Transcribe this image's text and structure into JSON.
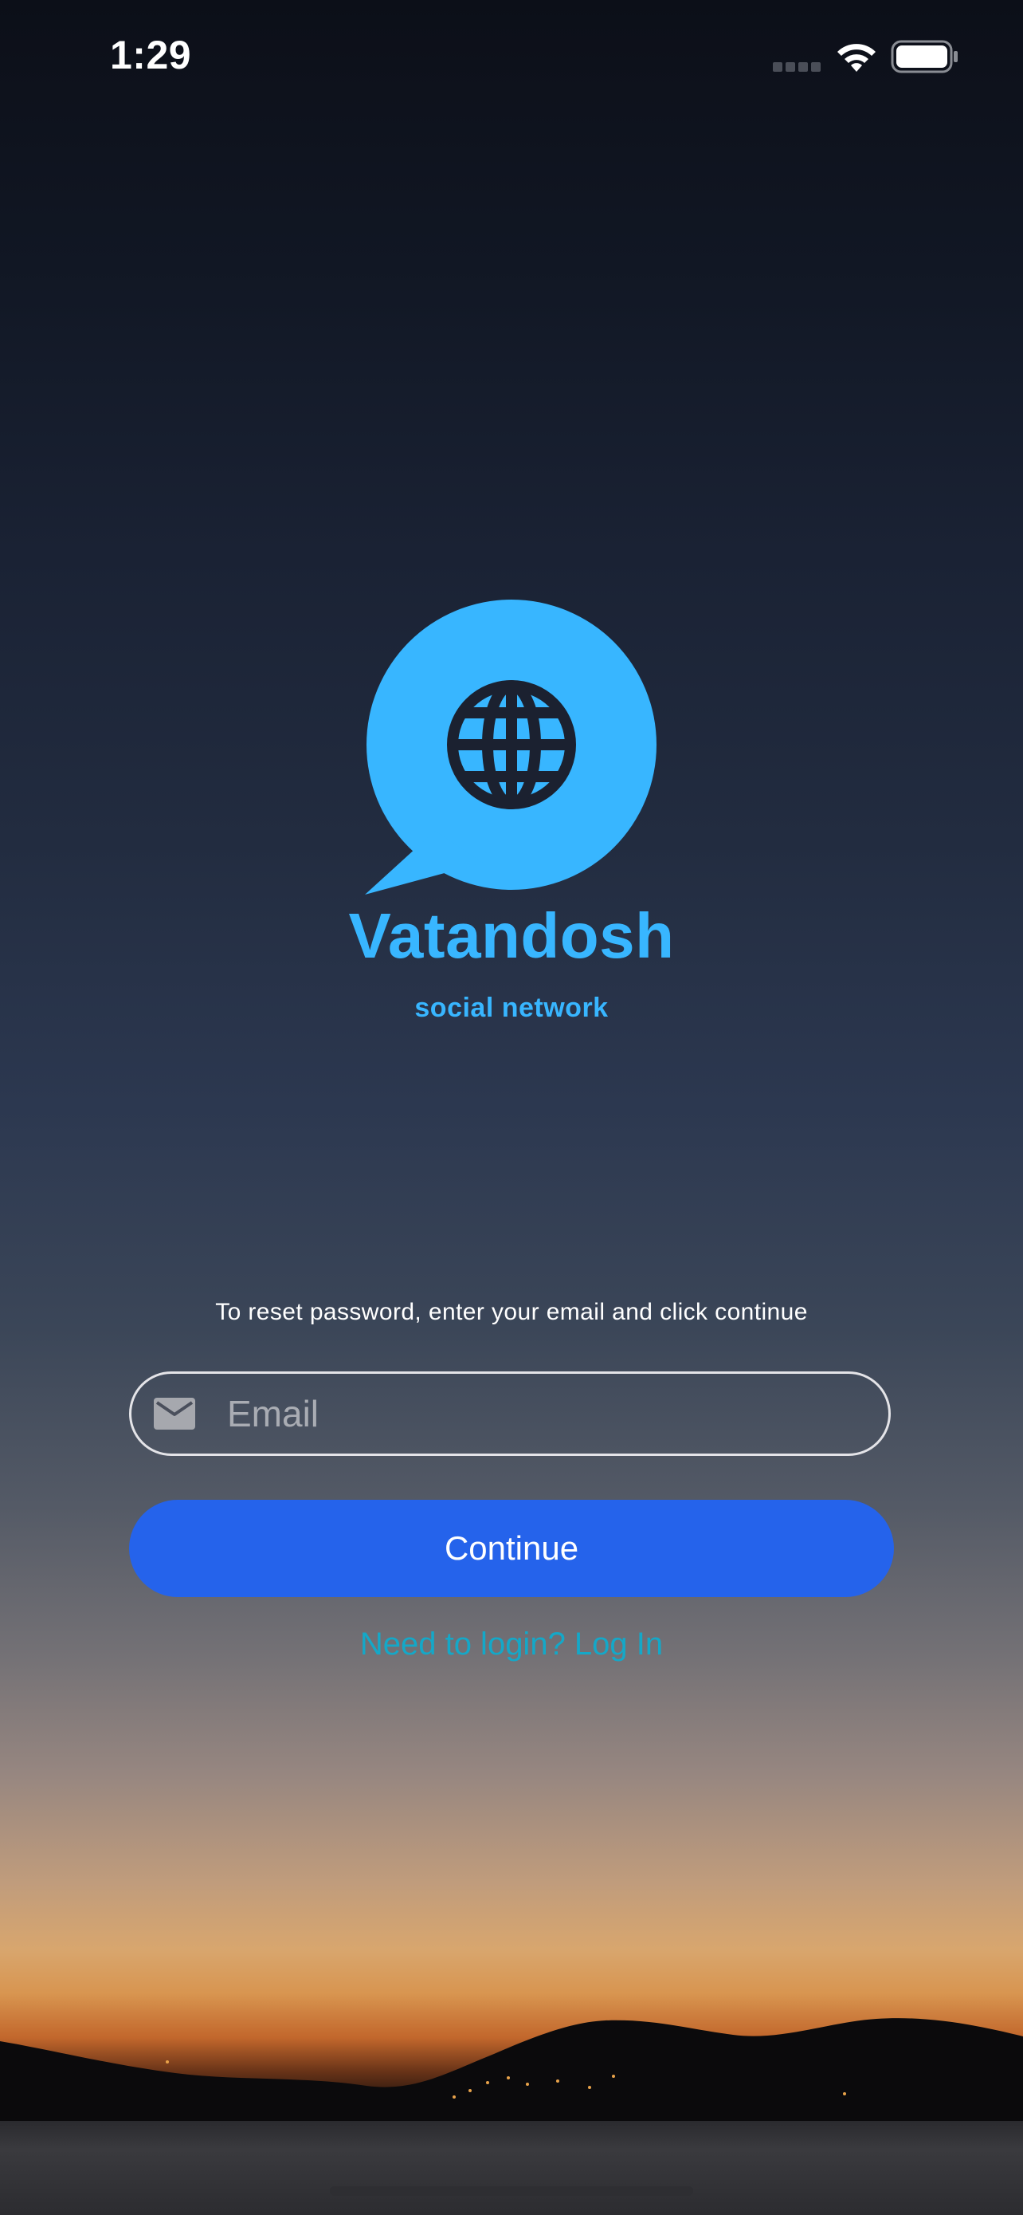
{
  "status_bar": {
    "time": "1:29",
    "icons": [
      "cellular-signal-icon",
      "wifi-icon",
      "battery-icon"
    ]
  },
  "brand": {
    "logo_icon": "globe-speech-bubble-icon",
    "name": "Vatandosh",
    "tagline": "social network",
    "color": "#38b6ff"
  },
  "reset_form": {
    "instruction": "To reset password, enter your email and click continue",
    "email": {
      "icon": "mail-icon",
      "placeholder": "Email",
      "value": ""
    },
    "continue_label": "Continue",
    "continue_color": "#2563eb",
    "login_link": "Need to login? Log In",
    "login_link_color": "#14a8c8"
  }
}
